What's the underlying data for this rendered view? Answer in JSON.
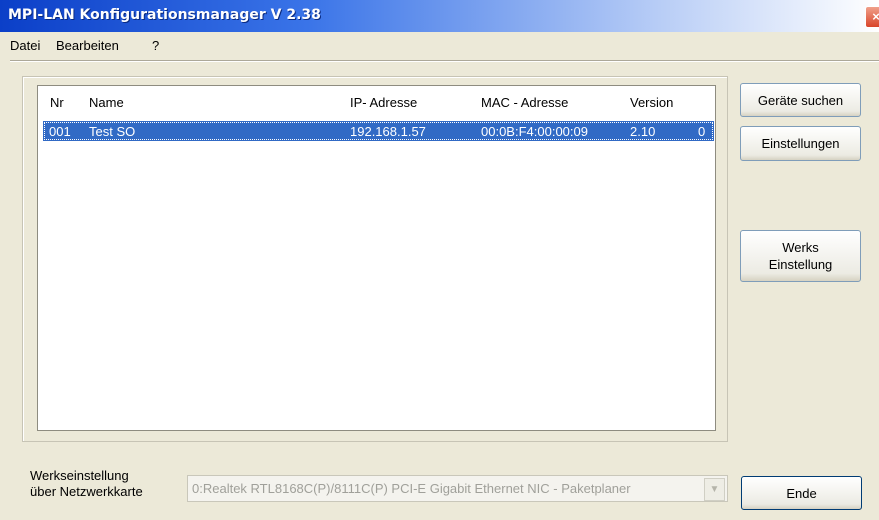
{
  "window": {
    "title": "MPI-LAN Konfigurationsmanager V 2.38",
    "close_label": "×"
  },
  "menu": {
    "items": [
      "Datei",
      "Bearbeiten",
      "?"
    ]
  },
  "list": {
    "columns": [
      "Nr",
      "Name",
      "IP- Adresse",
      "MAC - Adresse",
      "Version"
    ],
    "rows": [
      {
        "nr": "001",
        "name": "Test SO",
        "ip": "192.168.1.57",
        "mac": "00:0B:F4:00:00:09",
        "version": "2.10",
        "extra": "0"
      }
    ]
  },
  "buttons": {
    "search": "Geräte suchen",
    "settings": "Einstellungen",
    "factory_line1": "Werks",
    "factory_line2": "Einstellung",
    "end": "Ende"
  },
  "network": {
    "label_line1": "Werkseinstellung",
    "label_line2": "über Netzwerkkarte",
    "selected": "0:Realtek RTL8168C(P)/8111C(P) PCI-E Gigabit Ethernet NIC - Paketplaner"
  },
  "colors": {
    "selection": "#316ac5",
    "titlebar": "#0b3fc8",
    "window_bg": "#ece9d8"
  },
  "icons": {
    "close": "close-icon",
    "dropdown": "chevron-down-icon"
  }
}
